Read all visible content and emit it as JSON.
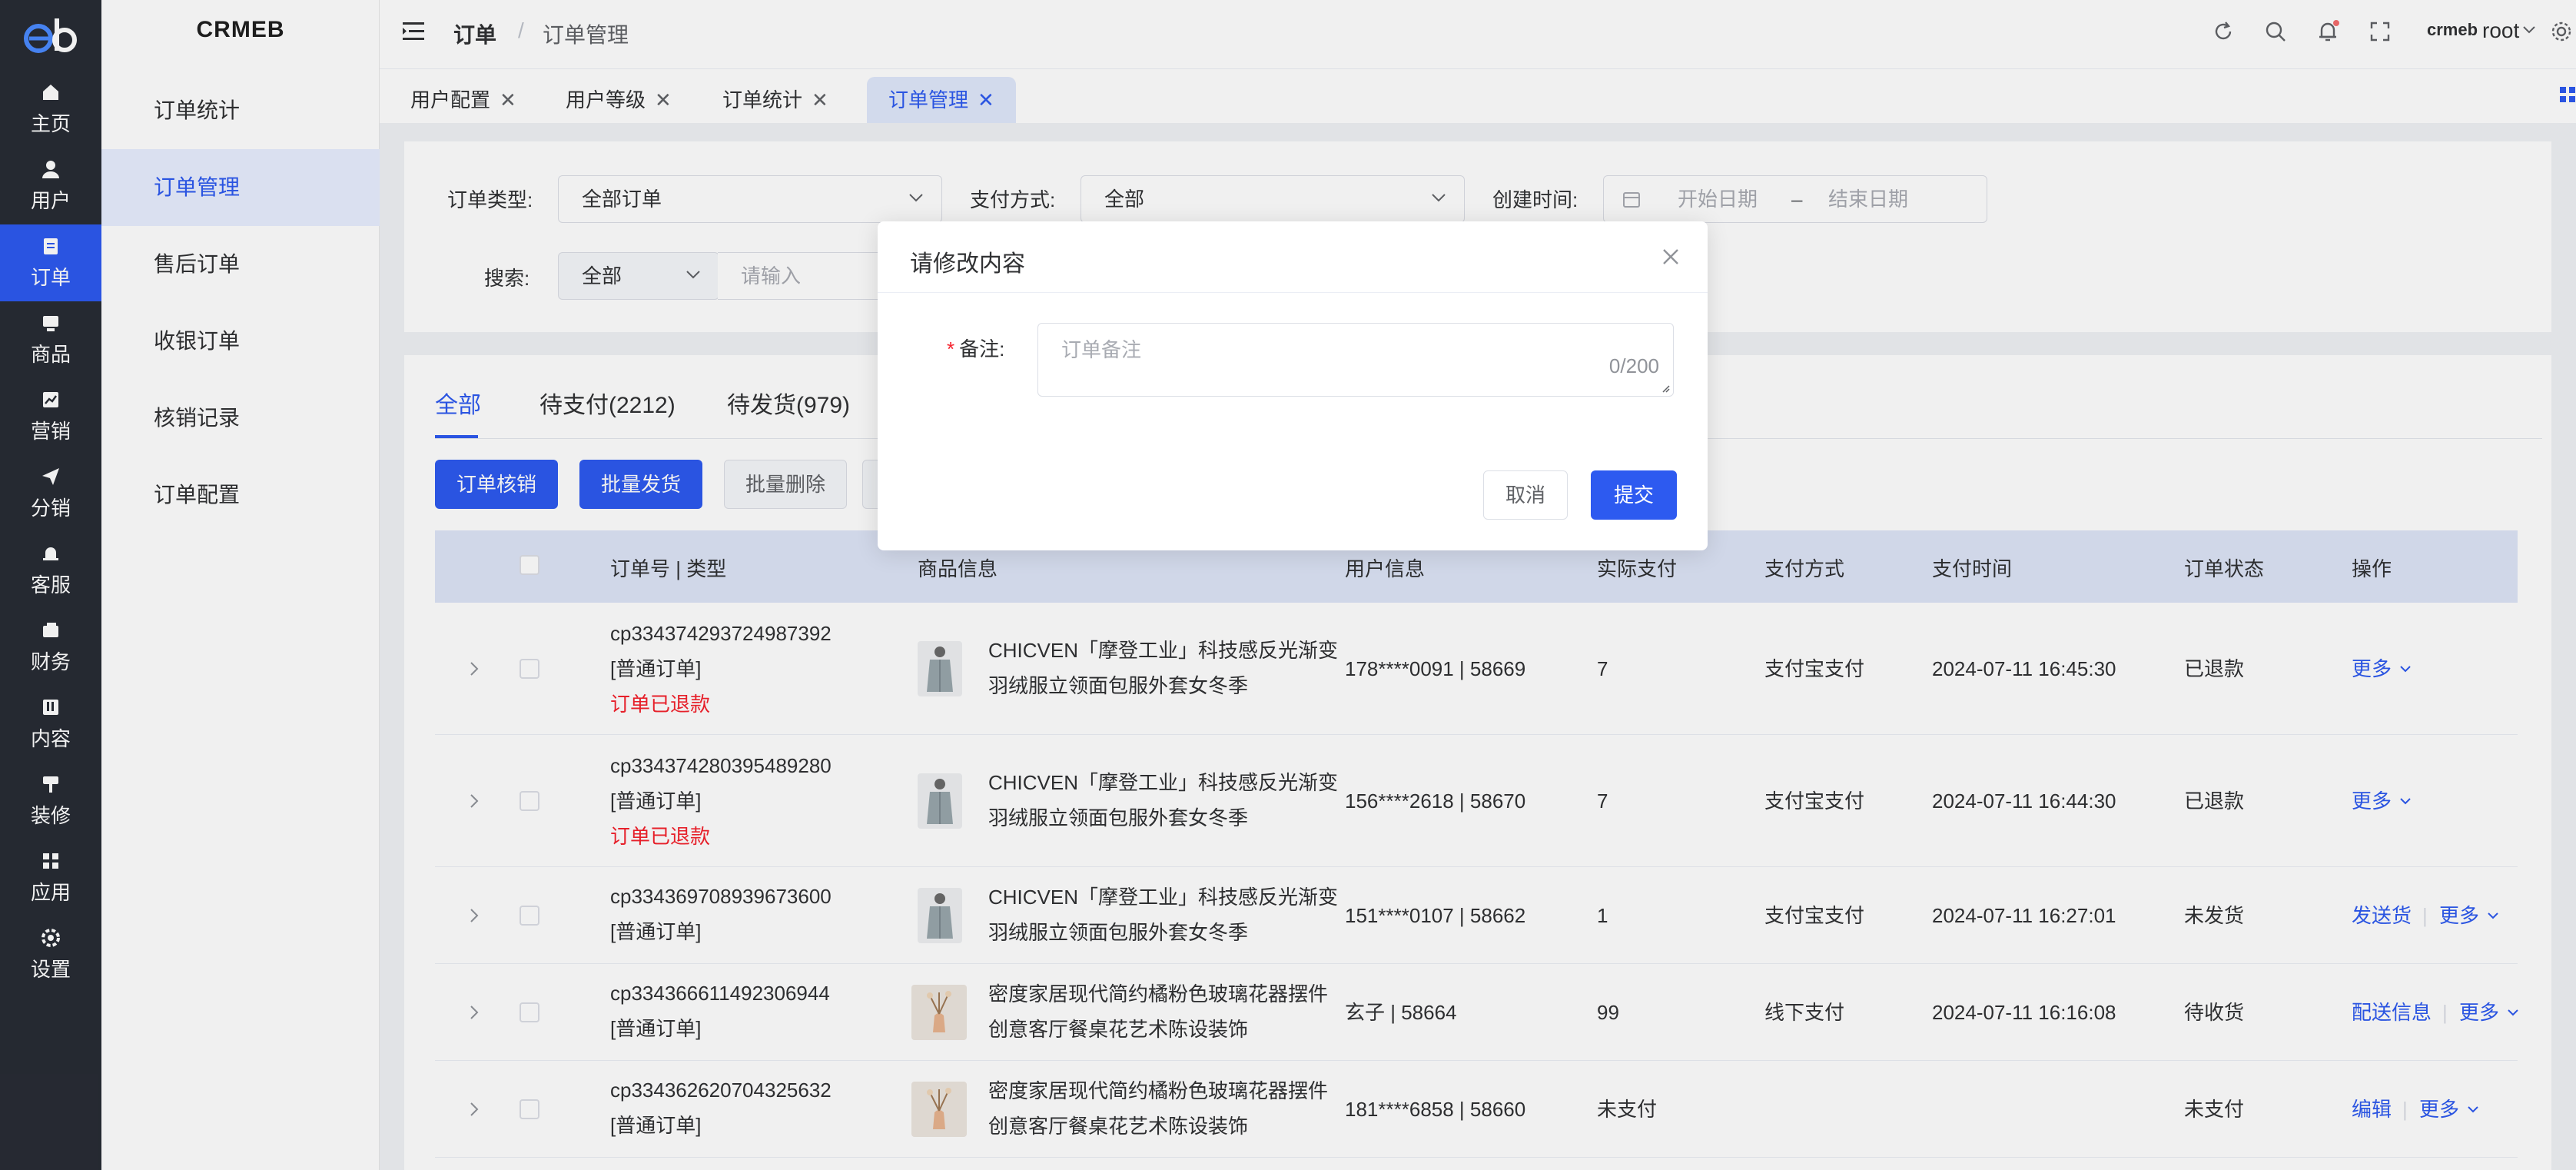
{
  "rail": {
    "items": [
      {
        "label": "主页",
        "icon": "home-icon"
      },
      {
        "label": "用户",
        "icon": "user-icon"
      },
      {
        "label": "订单",
        "icon": "order-icon"
      },
      {
        "label": "商品",
        "icon": "goods-icon"
      },
      {
        "label": "营销",
        "icon": "marketing-icon"
      },
      {
        "label": "分销",
        "icon": "distribution-icon"
      },
      {
        "label": "客服",
        "icon": "service-icon"
      },
      {
        "label": "财务",
        "icon": "finance-icon"
      },
      {
        "label": "内容",
        "icon": "content-icon"
      },
      {
        "label": "装修",
        "icon": "decorate-icon"
      },
      {
        "label": "应用",
        "icon": "apps-icon"
      },
      {
        "label": "设置",
        "icon": "settings-icon"
      }
    ],
    "active_color": "#2d5af0"
  },
  "subnav": {
    "brand": "CRMEB",
    "items": [
      {
        "label": "订单统计"
      },
      {
        "label": "订单管理"
      },
      {
        "label": "售后订单"
      },
      {
        "label": "收银订单"
      },
      {
        "label": "核销记录"
      },
      {
        "label": "订单配置"
      }
    ]
  },
  "header": {
    "breadcrumb_1": "订单",
    "breadcrumb_sep": "/",
    "breadcrumb_2": "订单管理",
    "user_name": "root",
    "user_logo_text": "crmeb"
  },
  "tabs": [
    {
      "label": "用户配置"
    },
    {
      "label": "用户等级"
    },
    {
      "label": "订单统计"
    },
    {
      "label": "订单管理"
    }
  ],
  "filters": {
    "order_type_label": "订单类型:",
    "order_type_value": "全部订单",
    "pay_method_label": "支付方式:",
    "pay_method_value": "全部",
    "created_label": "创建时间:",
    "start_placeholder": "开始日期",
    "range_sep": "–",
    "end_placeholder": "结束日期",
    "search_label": "搜索:",
    "search_scope": "全部",
    "search_placeholder": "请输入"
  },
  "order_tabs": [
    {
      "label": "全部"
    },
    {
      "label": "待支付(2212)"
    },
    {
      "label": "待发货(979)"
    }
  ],
  "actions": {
    "verify": "订单核销",
    "batch_ship": "批量发货",
    "batch_delete": "批量删除"
  },
  "table": {
    "headers": [
      "订单号 | 类型",
      "商品信息",
      "用户信息",
      "实际支付",
      "支付方式",
      "支付时间",
      "订单状态",
      "操作"
    ],
    "rows": [
      {
        "order_no": "cp334374293724987392",
        "type": "[普通订单]",
        "note": "订单已退款",
        "goods_1": "CHICVEN「摩登工业」科技感反光渐变",
        "goods_2": "羽绒服立领面包服外套女冬季",
        "user": "178****0091 | 58669",
        "paid": "7",
        "pay_method": "支付宝支付",
        "pay_time": "2024-07-11 16:45:30",
        "status": "已退款",
        "op1": "更多",
        "op2": ""
      },
      {
        "order_no": "cp334374280395489280",
        "type": "[普通订单]",
        "note": "订单已退款",
        "goods_1": "CHICVEN「摩登工业」科技感反光渐变",
        "goods_2": "羽绒服立领面包服外套女冬季",
        "user": "156****2618 | 58670",
        "paid": "7",
        "pay_method": "支付宝支付",
        "pay_time": "2024-07-11 16:44:30",
        "status": "已退款",
        "op1": "更多",
        "op2": ""
      },
      {
        "order_no": "cp334369708939673600",
        "type": "[普通订单]",
        "note": "",
        "goods_1": "CHICVEN「摩登工业」科技感反光渐变",
        "goods_2": "羽绒服立领面包服外套女冬季",
        "user": "151****0107 | 58662",
        "paid": "1",
        "pay_method": "支付宝支付",
        "pay_time": "2024-07-11 16:27:01",
        "status": "未发货",
        "op1": "发送货",
        "op2": "更多"
      },
      {
        "order_no": "cp334366611492306944",
        "type": "[普通订单]",
        "note": "",
        "goods_1": "密度家居现代简约橘粉色玻璃花器摆件",
        "goods_2": "创意客厅餐桌花艺术陈设装饰",
        "user": "玄子 | 58664",
        "paid": "99",
        "pay_method": "线下支付",
        "pay_time": "2024-07-11 16:16:08",
        "status": "待收货",
        "op1": "配送信息",
        "op2": "更多"
      },
      {
        "order_no": "cp334362620704325632",
        "type": "[普通订单]",
        "note": "",
        "goods_1": "密度家居现代简约橘粉色玻璃花器摆件",
        "goods_2": "创意客厅餐桌花艺术陈设装饰",
        "user": "181****6858 | 58660",
        "paid": "未支付",
        "pay_method": "",
        "pay_time": "",
        "status": "未支付",
        "op1": "编辑",
        "op2": "更多"
      }
    ]
  },
  "dialog": {
    "title": "请修改内容",
    "required_mark": "*",
    "remark_label": "备注:",
    "remark_placeholder": "订单备注",
    "counter": "0/200",
    "cancel": "取消",
    "submit": "提交"
  }
}
